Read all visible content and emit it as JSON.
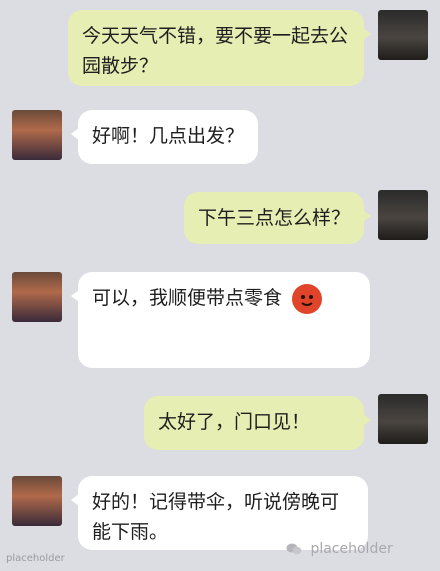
{
  "conversation": [
    {
      "side": "right",
      "text": "今天天气不错，要不要一起去公园散步？"
    },
    {
      "side": "left",
      "text": "好啊！几点出发？"
    },
    {
      "side": "right",
      "text": "下午三点怎么样？"
    },
    {
      "side": "left",
      "text": "可以，我顺便带点零食",
      "emoji": "smiling-face-emoji"
    },
    {
      "side": "right",
      "text": "太好了，门口见！"
    },
    {
      "side": "left",
      "text": "好的！记得带伞，听说傍晚可能下雨。"
    }
  ],
  "footer": {
    "left_watermark": "placeholder",
    "right_watermark": "placeholder"
  },
  "colors": {
    "background": "#dcdde2",
    "bubble_right": "#e6eeb3",
    "bubble_left": "#ffffff"
  }
}
